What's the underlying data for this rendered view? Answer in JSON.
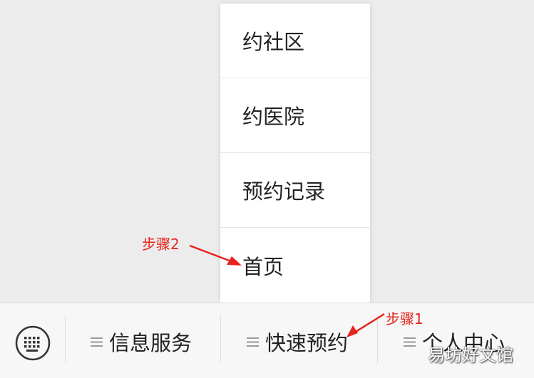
{
  "popup_menu": {
    "items": [
      {
        "label": "约社区"
      },
      {
        "label": "约医院"
      },
      {
        "label": "预约记录"
      },
      {
        "label": "首页"
      }
    ]
  },
  "bottom_bar": {
    "keyboard_icon": "keyboard-icon",
    "menus": [
      {
        "label": "信息服务",
        "icon": "menu-lines-icon"
      },
      {
        "label": "快速预约",
        "icon": "menu-lines-icon"
      },
      {
        "label": "个人中心",
        "icon": "menu-lines-icon"
      }
    ]
  },
  "annotations": {
    "step1": "步骤1",
    "step2": "步骤2",
    "color": "#e8231c"
  },
  "watermark": "易坊好文馆"
}
